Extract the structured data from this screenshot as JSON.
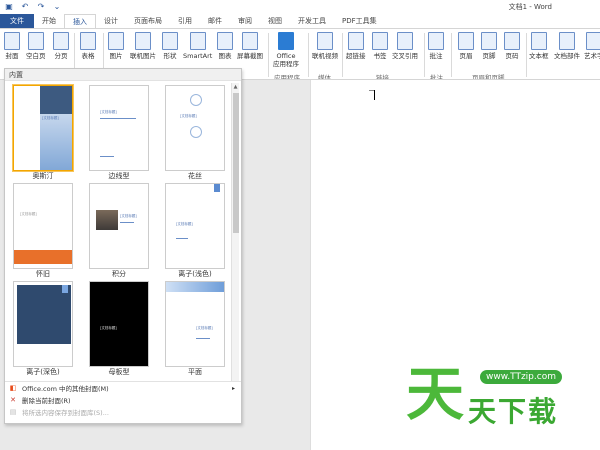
{
  "window": {
    "title": "文档1 - Word"
  },
  "qat": [
    {
      "name": "save-icon",
      "glyph": "▣"
    },
    {
      "name": "undo-icon",
      "glyph": "↶"
    },
    {
      "name": "redo-icon",
      "glyph": "↷"
    },
    {
      "name": "customize-qat-icon",
      "glyph": "⌄"
    }
  ],
  "tabs": [
    "文件",
    "开始",
    "插入",
    "设计",
    "页面布局",
    "引用",
    "邮件",
    "审阅",
    "视图",
    "开发工具",
    "PDF工具集"
  ],
  "active_tab": "插入",
  "ribbon": {
    "buttons": {
      "cover": "封面",
      "blank": "空白页",
      "pagebreak": "分页",
      "table": "表格",
      "picture": "图片",
      "onlinepic": "联机图片",
      "shapes": "形状",
      "smartart": "SmartArt",
      "chart": "图表",
      "screenshot": "屏幕截图",
      "office_apps_1": "Office",
      "office_apps_2": "应用程序",
      "onlinevideo": "联机视频",
      "hyperlink": "超链接",
      "bookmark": "书签",
      "crossref": "交叉引用",
      "comment": "批注",
      "header": "页眉",
      "footer": "页脚",
      "pagenum": "页码",
      "textbox": "文本框",
      "quickparts": "文档部件",
      "wordart": "艺术字"
    },
    "groups": {
      "apps": "应用程序",
      "media": "媒体",
      "links": "链接",
      "comments": "批注",
      "headerfooter": "页眉和页脚"
    }
  },
  "cover_gallery": {
    "section_label": "内置",
    "tiles": [
      {
        "caption": "奥斯汀",
        "placeholder": "[文档标题]"
      },
      {
        "caption": "边线型",
        "placeholder": "[文档标题]"
      },
      {
        "caption": "花丝",
        "placeholder": "[文档标题]"
      },
      {
        "caption": "怀旧",
        "placeholder": "[文档标题]"
      },
      {
        "caption": "积分",
        "placeholder": "[文档标题]"
      },
      {
        "caption": "离子(浅色)",
        "placeholder": "[文档标题]"
      },
      {
        "caption": "离子(深色)",
        "placeholder": ""
      },
      {
        "caption": "母板型",
        "placeholder": "[文档标题]"
      },
      {
        "caption": "平面",
        "placeholder": "[文档标题]"
      }
    ],
    "menu": [
      {
        "label": "Office.com 中的其他封面(M)",
        "icon": "office-icon",
        "glyph": "◧",
        "disabled": false
      },
      {
        "label": "删除当前封面(R)",
        "icon": "delete-cover-icon",
        "glyph": "✕",
        "disabled": false
      },
      {
        "label": "将所选内容保存到封面库(S)...",
        "icon": "save-to-gallery-icon",
        "glyph": "▤",
        "disabled": true
      }
    ],
    "submenu_arrow": "▸"
  },
  "watermark": {
    "url": "www.TTzip.com",
    "char": "天",
    "text": "天下载"
  },
  "colors": {
    "accent": "#2b579a",
    "selection": "#f3a600",
    "watermark": "#3caa3c"
  }
}
